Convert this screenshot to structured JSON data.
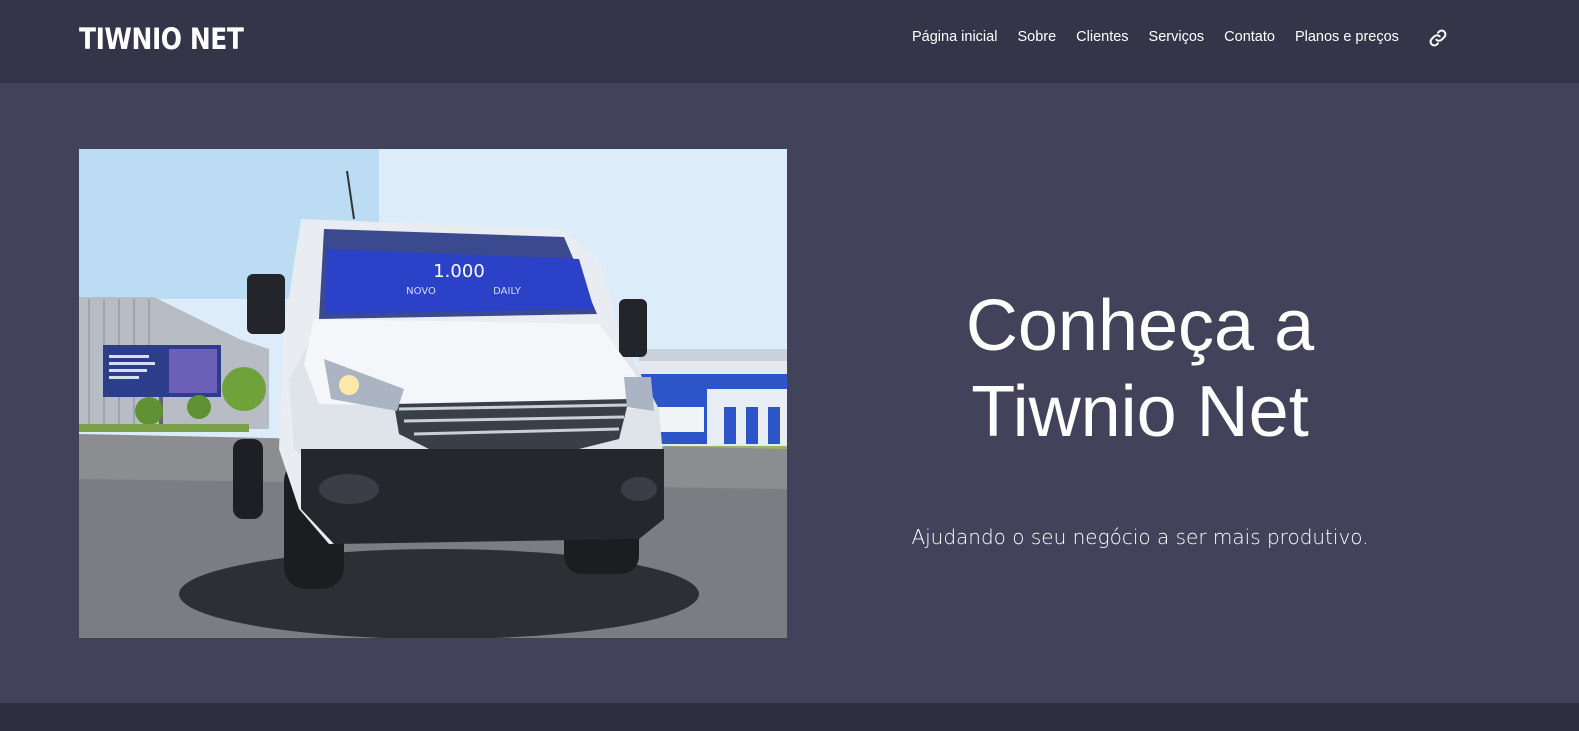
{
  "header": {
    "brand": "TIWNIO NET",
    "nav": [
      {
        "label": "Página inicial"
      },
      {
        "label": "Sobre"
      },
      {
        "label": "Clientes"
      },
      {
        "label": "Serviços"
      },
      {
        "label": "Contato"
      },
      {
        "label": "Planos e preços"
      }
    ],
    "link_icon": "link-icon"
  },
  "hero": {
    "image": {
      "windshield_number": "1.000",
      "windshield_left": "NOVO",
      "windshield_right": "DAILY"
    },
    "title_line1": "Conheça a",
    "title_line2": "Tiwnio Net",
    "subtitle": "Ajudando o seu negócio a ser mais produtivo."
  },
  "colors": {
    "header_bg": "#35354a",
    "page_bg": "#42435a",
    "text": "#ffffff"
  }
}
